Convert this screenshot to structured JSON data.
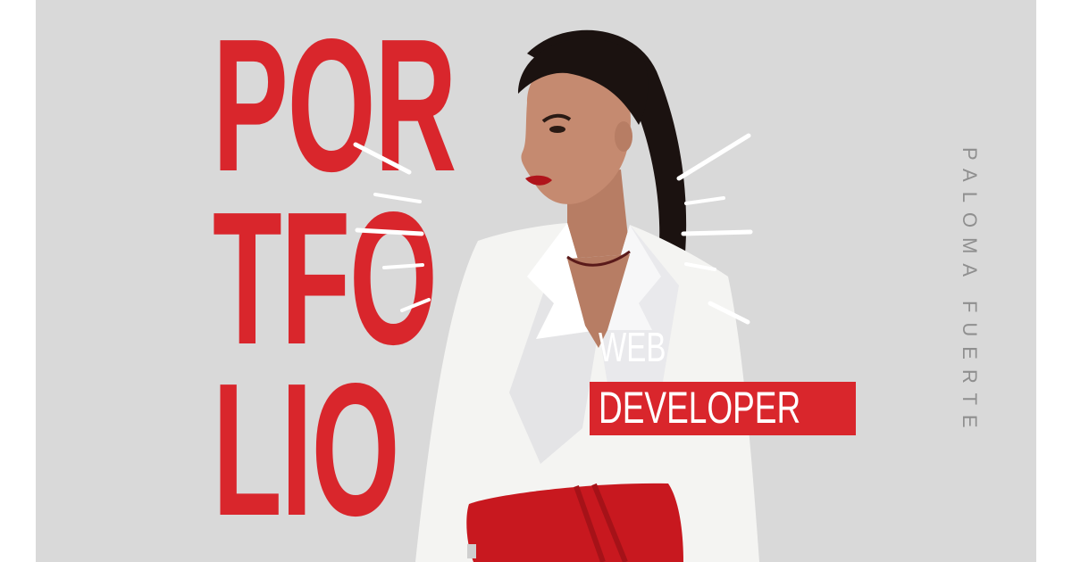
{
  "hero": {
    "title_lines": [
      "POR",
      "TFO",
      "LIO"
    ],
    "role_line1": "WEB",
    "role_line2": "DEVELOPER",
    "name": "PALOMA FUERTE"
  },
  "colors": {
    "background": "#d9d9d9",
    "accent": "#d9262c",
    "text_light": "#ffffff",
    "name_text": "#8f8f8f"
  },
  "image": {
    "subject": "woman in white blazer with red handbag"
  }
}
